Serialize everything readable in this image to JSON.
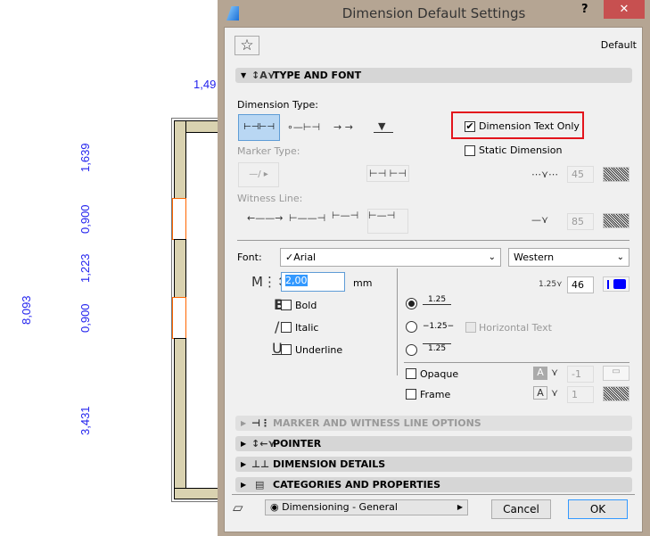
{
  "drawing": {
    "dimensions": [
      "1,49",
      "1,639",
      "0,900",
      "1,223",
      "0,900",
      "8,093",
      "3,431"
    ],
    "dim_color": "#2222ee"
  },
  "dialog": {
    "title": "Dimension Default Settings",
    "help_label": "?",
    "close_label": "✕",
    "favorite_icon": "star-icon",
    "preset_name": "Default",
    "sections": {
      "type_and_font": "TYPE AND FONT",
      "marker_witness": "MARKER AND WITNESS LINE OPTIONS",
      "pointer": "POINTER",
      "dimension_details": "DIMENSION DETAILS",
      "categories": "CATEGORIES AND PROPERTIES"
    },
    "dimension_type_label": "Dimension Type:",
    "dimension_text_only": {
      "label": "Dimension Text Only",
      "checked": true,
      "highlight_color": "#e3141c"
    },
    "static_dimension": {
      "label": "Static Dimension",
      "checked": false
    },
    "marker_type_label": "Marker Type:",
    "witness_line_label": "Witness Line:",
    "marker_pen": "45",
    "witness_pen": "85",
    "font": {
      "label": "Font:",
      "value": "✓Arial",
      "script": "Western",
      "size": "2,00",
      "unit": "mm",
      "pen": "46",
      "pen_color": "#0000ff",
      "text_sample": "1.25"
    },
    "styles": {
      "bold": "Bold",
      "italic": "Italic",
      "underline": "Underline"
    },
    "placement": {
      "options": [
        "1.25",
        "−1.25−",
        "1.25"
      ],
      "selected": 0,
      "horizontal_text": "Horizontal Text"
    },
    "opaque": {
      "label": "Opaque",
      "pen": "-1"
    },
    "frame": {
      "label": "Frame",
      "pen": "1"
    },
    "layer": "Dimensioning - General",
    "cancel": "Cancel",
    "ok": "OK",
    "close_color": "#c75050"
  }
}
